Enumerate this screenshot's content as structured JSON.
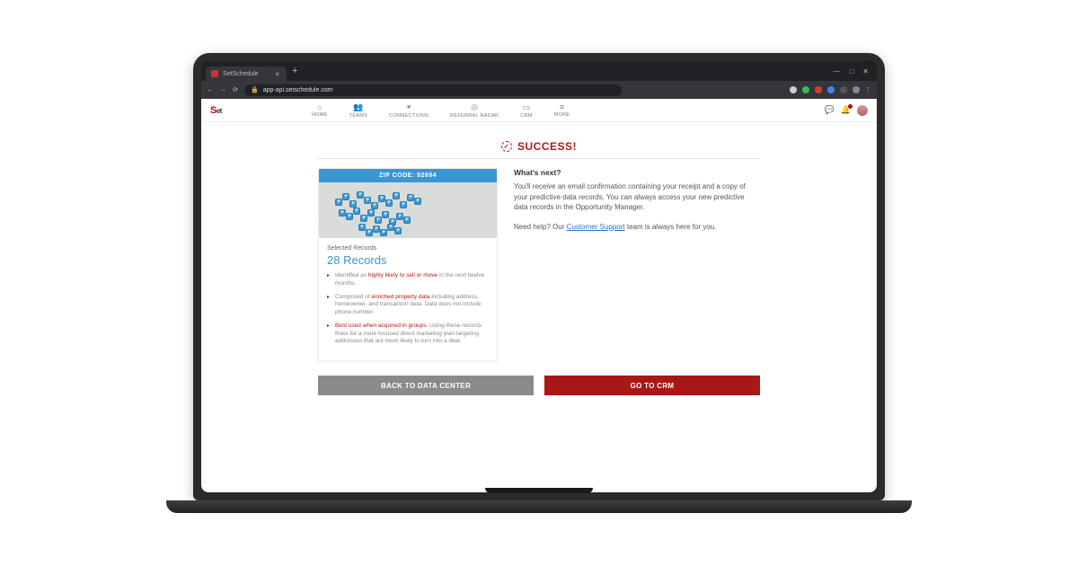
{
  "browser": {
    "tab_title": "SetSchedule",
    "url": "app-api.setschedule.com",
    "window_controls": {
      "min": "—",
      "max": "□",
      "close": "✕"
    }
  },
  "header": {
    "logo_main": "S",
    "logo_rest": "et",
    "nav": [
      {
        "label": "HOME"
      },
      {
        "label": "TEAMS"
      },
      {
        "label": "CONNECTIONS"
      },
      {
        "label": "REFERRAL RADAR"
      },
      {
        "label": "CRM"
      },
      {
        "label": "MORE"
      }
    ]
  },
  "success": {
    "title": "SUCCESS!"
  },
  "card": {
    "zip_label": "ZIP CODE: 92694",
    "selected_label": "Selected Records",
    "records": "28 Records",
    "bullets": [
      {
        "pre": "Identified as ",
        "hl": "highly likely to sell or move",
        "post": " in the next twelve months."
      },
      {
        "pre": "Comprised of ",
        "hl": "enriched property data",
        "post": " including address, homeowner, and transaction data. Data does not include phone number."
      },
      {
        "pre": "",
        "hl": "Best used when acquired in groups.",
        "post": " Using these records flows for a more focused direct marketing plan targeting addresses that are more likely to turn into a deal."
      }
    ]
  },
  "right": {
    "heading": "What's next?",
    "body": "You'll receive an email confirmation containing your receipt and a copy of your predictive data records. You can always access your new predictive data records in the Opportunity Manager.",
    "help_pre": "Need help? Our ",
    "help_link": "Customer Support",
    "help_post": " team is always here for you."
  },
  "buttons": {
    "back": "BACK TO DATA CENTER",
    "crm": "GO TO CRM"
  },
  "pins": [
    {
      "l": 18,
      "t": 18
    },
    {
      "l": 26,
      "t": 12
    },
    {
      "l": 34,
      "t": 20
    },
    {
      "l": 42,
      "t": 10
    },
    {
      "l": 50,
      "t": 16
    },
    {
      "l": 58,
      "t": 22
    },
    {
      "l": 66,
      "t": 14
    },
    {
      "l": 74,
      "t": 19
    },
    {
      "l": 82,
      "t": 11
    },
    {
      "l": 90,
      "t": 21
    },
    {
      "l": 98,
      "t": 13
    },
    {
      "l": 106,
      "t": 17
    },
    {
      "l": 22,
      "t": 30
    },
    {
      "l": 30,
      "t": 34
    },
    {
      "l": 38,
      "t": 28
    },
    {
      "l": 46,
      "t": 36
    },
    {
      "l": 54,
      "t": 30
    },
    {
      "l": 62,
      "t": 38
    },
    {
      "l": 70,
      "t": 32
    },
    {
      "l": 78,
      "t": 40
    },
    {
      "l": 86,
      "t": 34
    },
    {
      "l": 94,
      "t": 38
    },
    {
      "l": 44,
      "t": 46
    },
    {
      "l": 60,
      "t": 48
    },
    {
      "l": 76,
      "t": 46
    },
    {
      "l": 52,
      "t": 52
    },
    {
      "l": 68,
      "t": 52
    },
    {
      "l": 84,
      "t": 50
    }
  ]
}
